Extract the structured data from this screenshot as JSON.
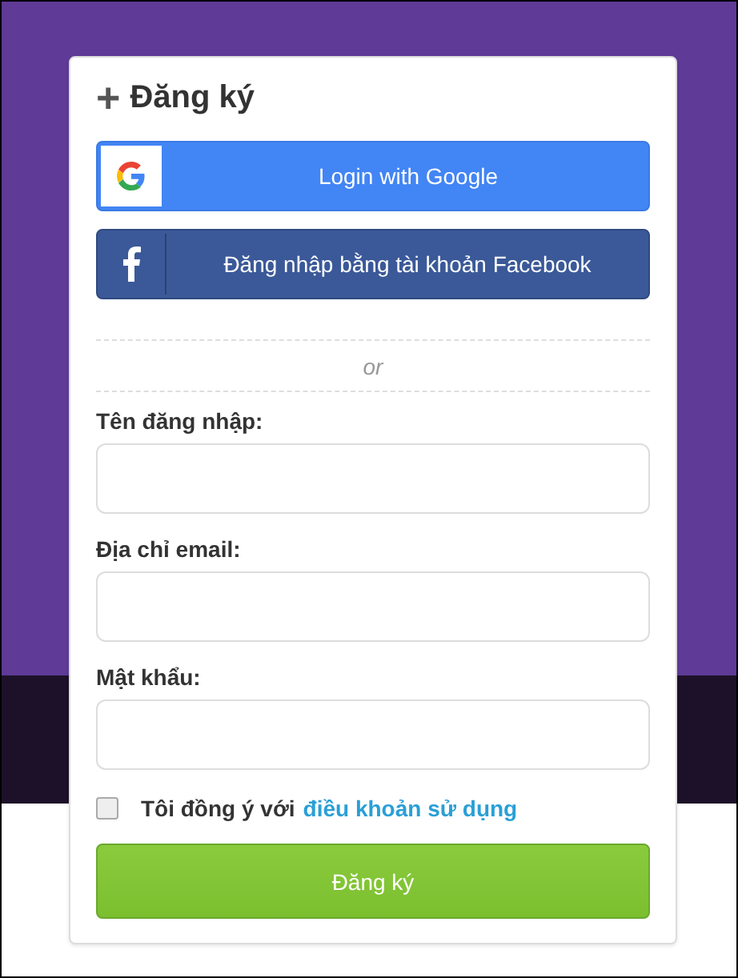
{
  "title": {
    "icon": "+",
    "text": "Đăng ký"
  },
  "social_buttons": [
    {
      "kind": "google",
      "label": "Login with Google"
    },
    {
      "kind": "facebook",
      "label": "Đăng nhập bằng tài khoản Facebook"
    }
  ],
  "separator": "or",
  "fields": [
    {
      "label": "Tên đăng nhập:"
    },
    {
      "label": "Địa chỉ email:"
    },
    {
      "label": "Mật khẩu:"
    }
  ],
  "terms": {
    "checked": false,
    "text": "Tôi đồng ý với",
    "link": "điều khoản sử dụng"
  },
  "submit": "Đăng ký"
}
